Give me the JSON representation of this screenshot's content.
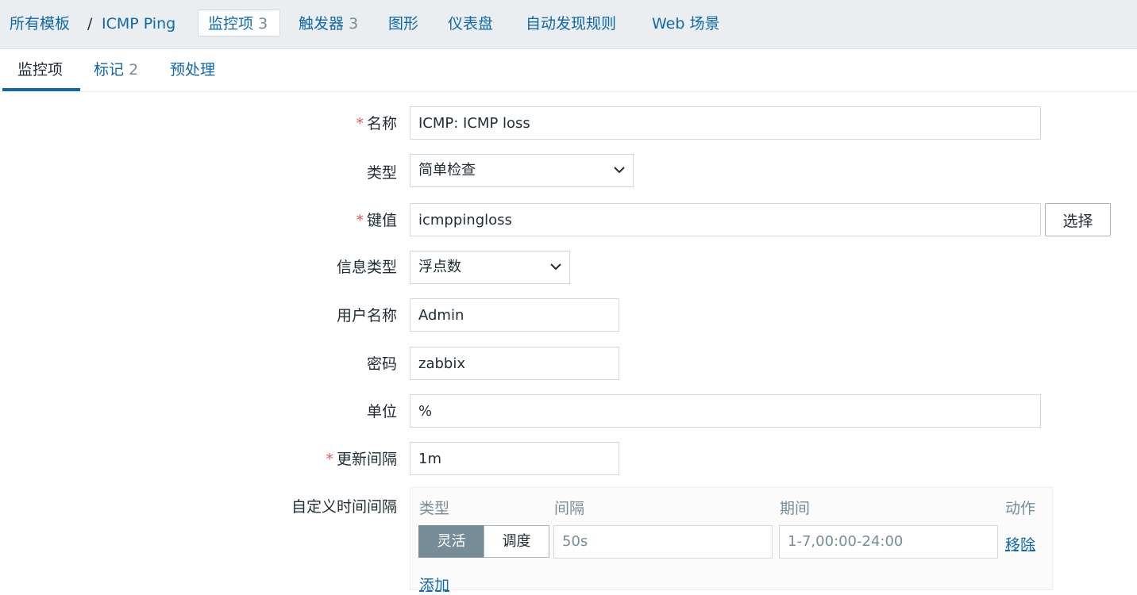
{
  "breadcrumb": {
    "all_templates": "所有模板",
    "separator": "/",
    "template": "ICMP Ping"
  },
  "tabs": [
    {
      "label": "监控项",
      "count": "3"
    },
    {
      "label": "触发器",
      "count": "3"
    },
    {
      "label": "图形"
    },
    {
      "label": "仪表盘"
    },
    {
      "label": "自动发现规则"
    },
    {
      "label": "Web 场景"
    }
  ],
  "subtabs": [
    {
      "label": "监控项"
    },
    {
      "label": "标记",
      "count": "2"
    },
    {
      "label": "预处理"
    }
  ],
  "form": {
    "required_mark": "*",
    "name_label": "名称",
    "name_value": "ICMP: ICMP loss",
    "type_label": "类型",
    "type_value": "简单检查",
    "key_label": "键值",
    "key_value": "icmppingloss",
    "select_button": "选择",
    "info_type_label": "信息类型",
    "info_type_value": "浮点数",
    "username_label": "用户名称",
    "username_value": "Admin",
    "password_label": "密码",
    "password_value": "zabbix",
    "units_label": "单位",
    "units_value": "%",
    "interval_label": "更新间隔",
    "interval_value": "1m",
    "custom_intervals_label": "自定义时间间隔"
  },
  "custom_intervals": {
    "headers": {
      "type": "类型",
      "interval": "间隔",
      "period": "期间",
      "action": "动作"
    },
    "row": {
      "flexible": "灵活",
      "scheduling": "调度",
      "interval_placeholder": "50s",
      "period_placeholder": "1-7,00:00-24:00",
      "remove": "移除"
    },
    "add": "添加"
  },
  "icons": {
    "dropdown": "chevron-down-icon"
  },
  "colors": {
    "link": "#0f68ad",
    "required": "#e45959",
    "muted": "#768d99",
    "nav_bg": "#ebeef0"
  }
}
